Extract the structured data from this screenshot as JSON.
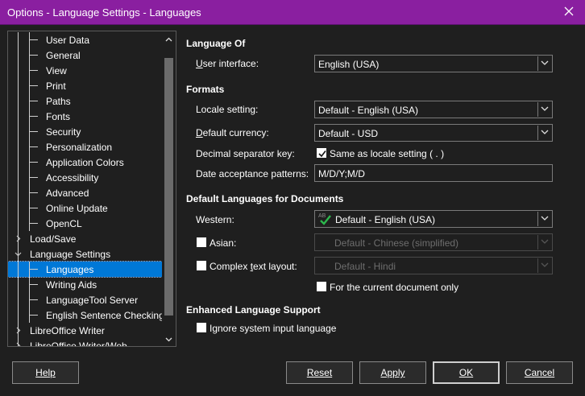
{
  "window": {
    "title": "Options - Language Settings - Languages"
  },
  "tree": {
    "items": [
      {
        "label": "User Data",
        "level": 2
      },
      {
        "label": "General",
        "level": 2
      },
      {
        "label": "View",
        "level": 2
      },
      {
        "label": "Print",
        "level": 2
      },
      {
        "label": "Paths",
        "level": 2
      },
      {
        "label": "Fonts",
        "level": 2
      },
      {
        "label": "Security",
        "level": 2
      },
      {
        "label": "Personalization",
        "level": 2
      },
      {
        "label": "Application Colors",
        "level": 2
      },
      {
        "label": "Accessibility",
        "level": 2
      },
      {
        "label": "Advanced",
        "level": 2
      },
      {
        "label": "Online Update",
        "level": 2
      },
      {
        "label": "OpenCL",
        "level": 2
      },
      {
        "label": "Load/Save",
        "level": 1,
        "expanded": false
      },
      {
        "label": "Language Settings",
        "level": 1,
        "expanded": true
      },
      {
        "label": "Languages",
        "level": 2,
        "selected": true
      },
      {
        "label": "Writing Aids",
        "level": 2
      },
      {
        "label": "LanguageTool Server",
        "level": 2
      },
      {
        "label": "English Sentence Checking",
        "level": 2
      },
      {
        "label": "LibreOffice Writer",
        "level": 1,
        "expanded": false
      },
      {
        "label": "LibreOffice Writer/Web",
        "level": 1,
        "expanded": false
      }
    ]
  },
  "language_of": {
    "heading": "Language Of",
    "user_interface_label": "User interface:",
    "user_interface_value": "English (USA)"
  },
  "formats": {
    "heading": "Formats",
    "locale_label": "Locale setting:",
    "locale_value": "Default - English (USA)",
    "currency_label": "Default currency:",
    "currency_value": "Default - USD",
    "decimal_label": "Decimal separator key:",
    "decimal_checkbox_label": "Same as locale setting ( . )",
    "decimal_checked": true,
    "date_label": "Date acceptance patterns:",
    "date_value": "M/D/Y;M/D"
  },
  "default_languages": {
    "heading": "Default Languages for Documents",
    "western_label": "Western:",
    "western_value": "Default - English (USA)",
    "asian_label": "Asian:",
    "asian_value": "Default - Chinese (simplified)",
    "asian_checked": false,
    "ctl_label": "Complex text layout:",
    "ctl_value": "Default - Hindi",
    "ctl_checked": false,
    "current_doc_label": "For the current document only",
    "current_doc_checked": false
  },
  "enhanced": {
    "heading": "Enhanced Language Support",
    "ignore_label": "Ignore system input language",
    "ignore_checked": false
  },
  "buttons": {
    "help": "Help",
    "reset": "Reset",
    "apply": "Apply",
    "ok": "OK",
    "cancel": "Cancel"
  },
  "colors": {
    "titlebar": "#8a1fa0",
    "background": "#1f1f1f",
    "selection": "#0078d7"
  }
}
